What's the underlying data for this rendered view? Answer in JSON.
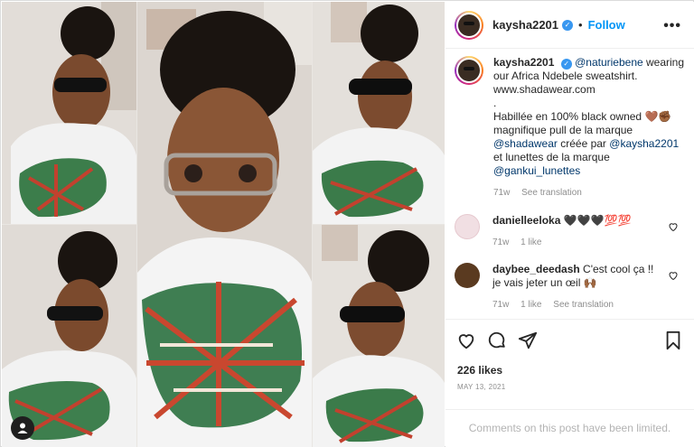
{
  "header": {
    "username": "kaysha2201",
    "verified_mark": "✓",
    "separator": "•",
    "follow_label": "Follow",
    "more_label": "•••"
  },
  "caption": {
    "username": "kaysha2201",
    "mention1": "@naturiebene",
    "line1_rest": " wearing our Africa Ndebele sweatshirt. www.shadawear.com",
    "dot": ".",
    "fr_text1": "Habillée en 100% black owned 🤎✊🏾 magnifique pull de la marque ",
    "mention2": "@shadawear",
    "fr_text2": " créée par ",
    "mention3": "@kaysha2201",
    "fr_text3": " et lunettes de la marque ",
    "mention4": "@gankui_lunettes",
    "age": "71w",
    "see_translation": "See translation"
  },
  "comments": [
    {
      "username": "danielleeloka",
      "text": " 🖤🖤🖤💯💯",
      "age": "71w",
      "likes": "1 like"
    },
    {
      "username": "daybee_deedash",
      "text": " C'est cool ça !! je vais jeter un œil 🙌🏾",
      "age": "71w",
      "likes": "1 like",
      "see_translation": "See translation"
    }
  ],
  "actions": {
    "likes": "226 likes",
    "date": "MAY 13, 2021"
  },
  "footer": {
    "limited": "Comments on this post have been limited."
  },
  "icons": [
    "heart-icon",
    "comment-icon",
    "share-icon",
    "bookmark-icon",
    "user-tag-icon",
    "verified-icon"
  ],
  "colors": {
    "link": "#00376b",
    "follow": "#0095f6",
    "muted": "#8e8e8e",
    "verified": "#3897f0"
  }
}
